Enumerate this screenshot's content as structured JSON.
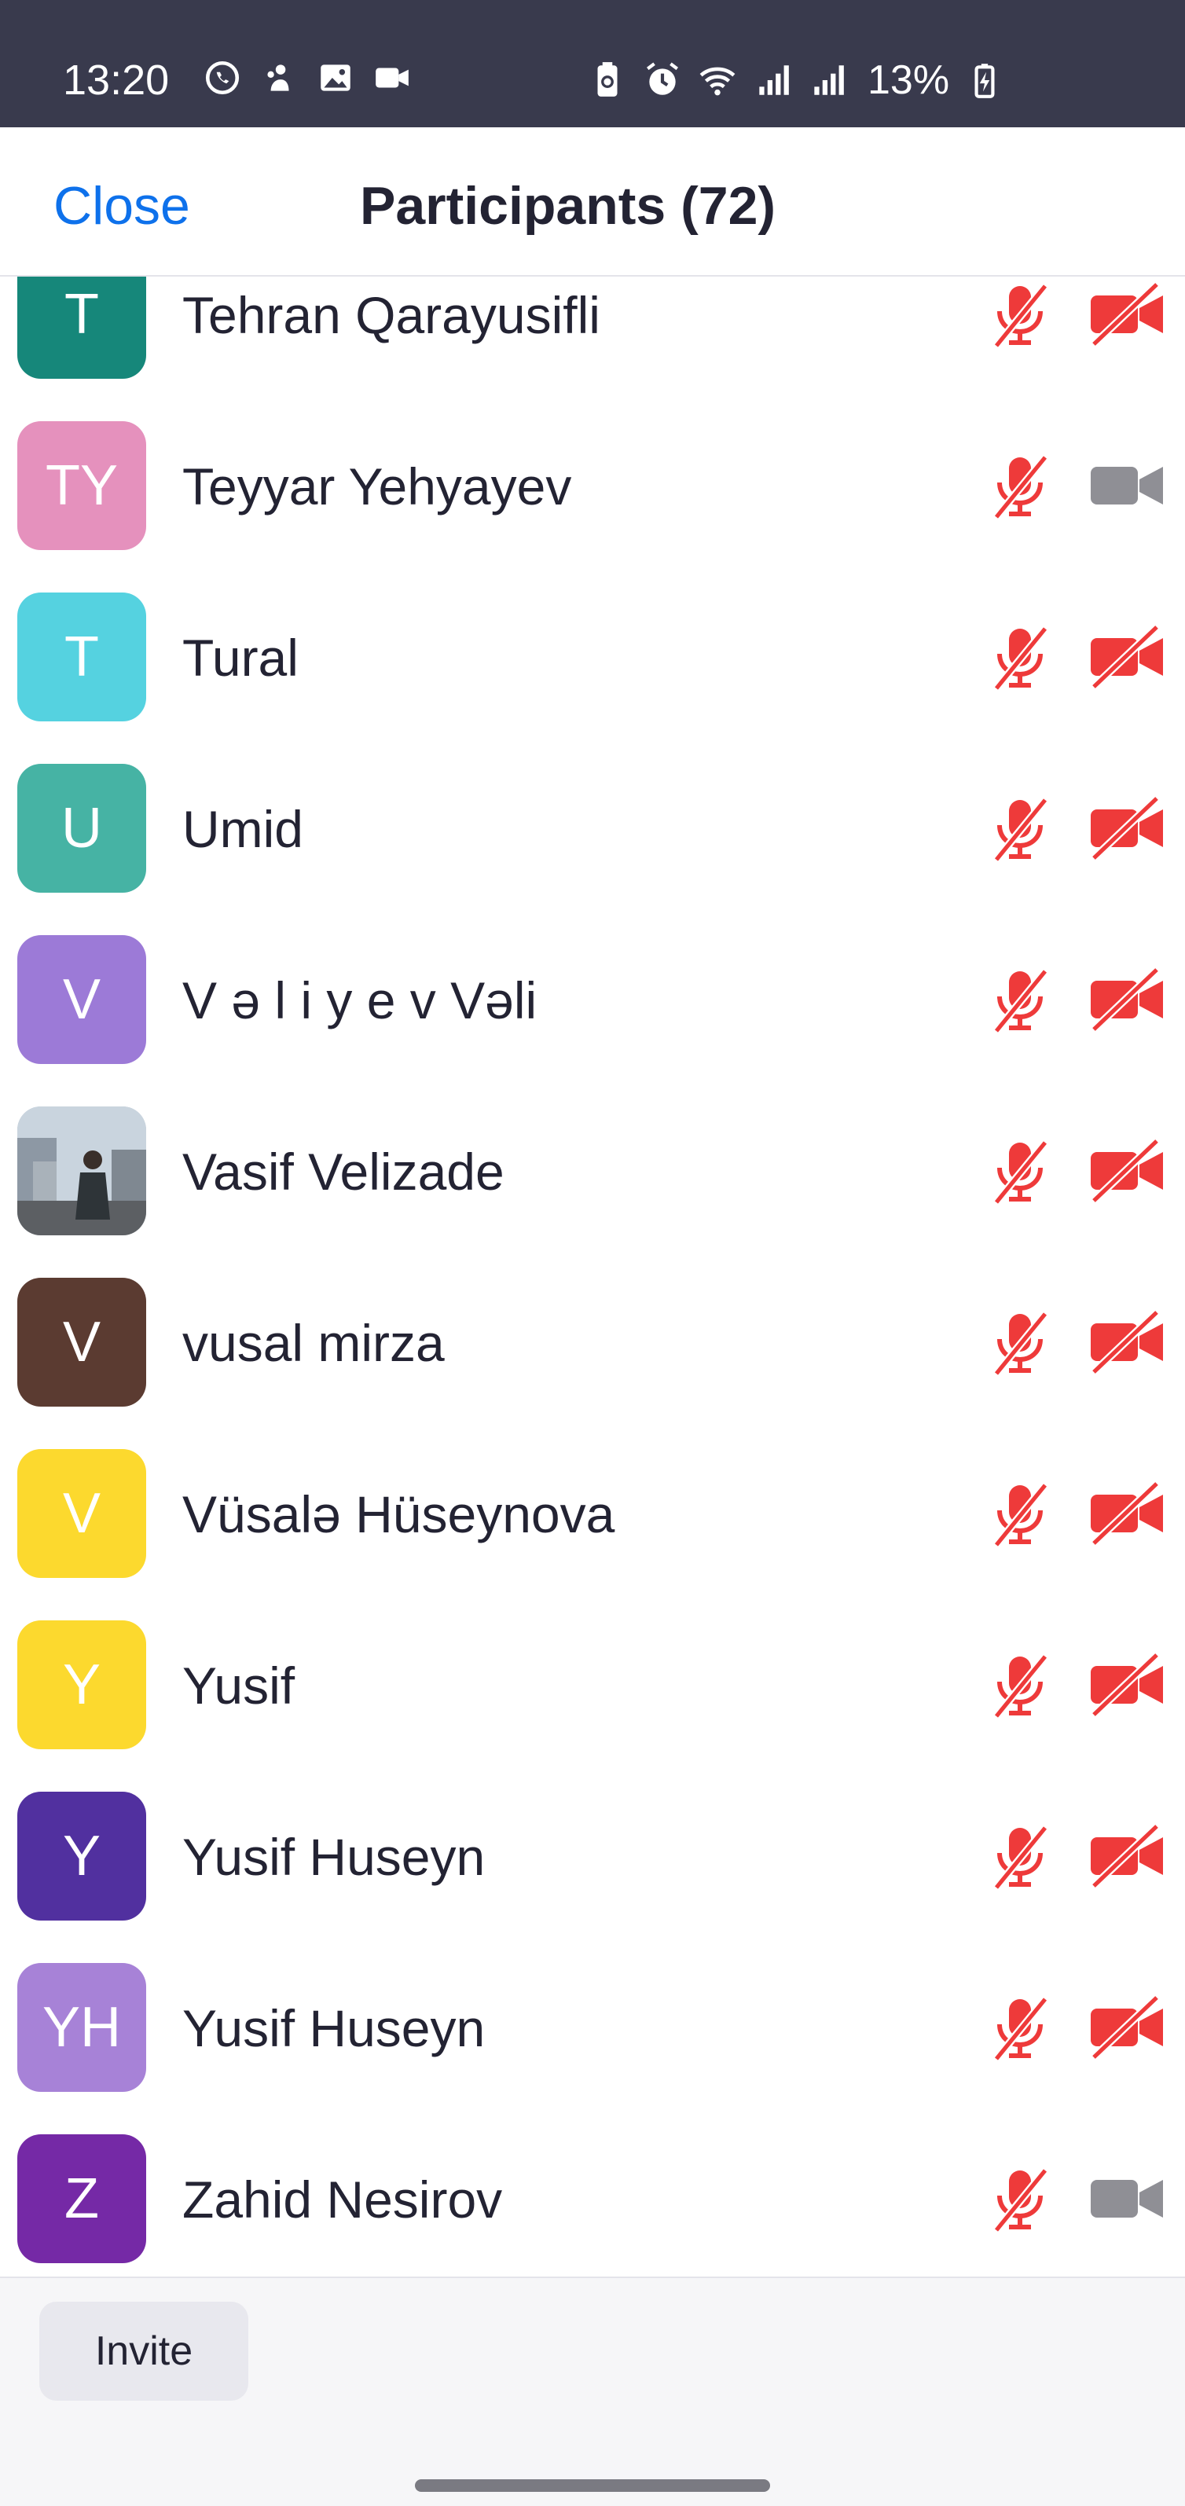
{
  "status_bar": {
    "time": "13:20",
    "battery_percent": "13%",
    "left_icons": [
      "whatsapp-icon",
      "notification-icon",
      "gallery-icon",
      "video-icon"
    ],
    "right_icons": [
      "battery-saver-icon",
      "alarm-icon",
      "wifi-icon",
      "signal-icon",
      "signal-icon",
      "battery-charging-icon"
    ]
  },
  "header": {
    "close_label": "Close",
    "title": "Participants (72)"
  },
  "colors": {
    "accent": "#0e71eb",
    "muted_red": "#ee3a3a",
    "video_on_gray": "#8f8f95",
    "status_bar_bg": "#393a4d"
  },
  "participants": [
    {
      "initials": "T",
      "name": "Tehran Qarayusifli",
      "avatar_color": "#16877a",
      "muted": true,
      "video_on": false
    },
    {
      "initials": "TY",
      "name": "Teyyar Yehyayev",
      "avatar_color": "#e591bd",
      "muted": true,
      "video_on": true
    },
    {
      "initials": "T",
      "name": "Tural",
      "avatar_color": "#55d2e0",
      "muted": true,
      "video_on": false
    },
    {
      "initials": "U",
      "name": "Umid",
      "avatar_color": "#46b3a4",
      "muted": true,
      "video_on": false
    },
    {
      "initials": "V",
      "name": "V ə l i y e v  Vəli",
      "avatar_color": "#9c7ad7",
      "muted": true,
      "video_on": false
    },
    {
      "initials": "",
      "name": "Vasif Velizade",
      "avatar_color": "photo",
      "muted": true,
      "video_on": false
    },
    {
      "initials": "V",
      "name": "vusal mirza",
      "avatar_color": "#5b3b31",
      "muted": true,
      "video_on": false
    },
    {
      "initials": "V",
      "name": "Vüsalə Hüseynova",
      "avatar_color": "#fcd92e",
      "muted": true,
      "video_on": false
    },
    {
      "initials": "Y",
      "name": "Yusif",
      "avatar_color": "#fcd92e",
      "muted": true,
      "video_on": false
    },
    {
      "initials": "Y",
      "name": "Yusif Huseyn",
      "avatar_color": "#51309f",
      "muted": true,
      "video_on": false
    },
    {
      "initials": "YH",
      "name": "Yusif Huseyn",
      "avatar_color": "#a782d7",
      "muted": true,
      "video_on": false
    },
    {
      "initials": "Z",
      "name": "Zahid Nesirov",
      "avatar_color": "#7529a6",
      "muted": true,
      "video_on": true
    }
  ],
  "footer": {
    "invite_label": "Invite"
  }
}
